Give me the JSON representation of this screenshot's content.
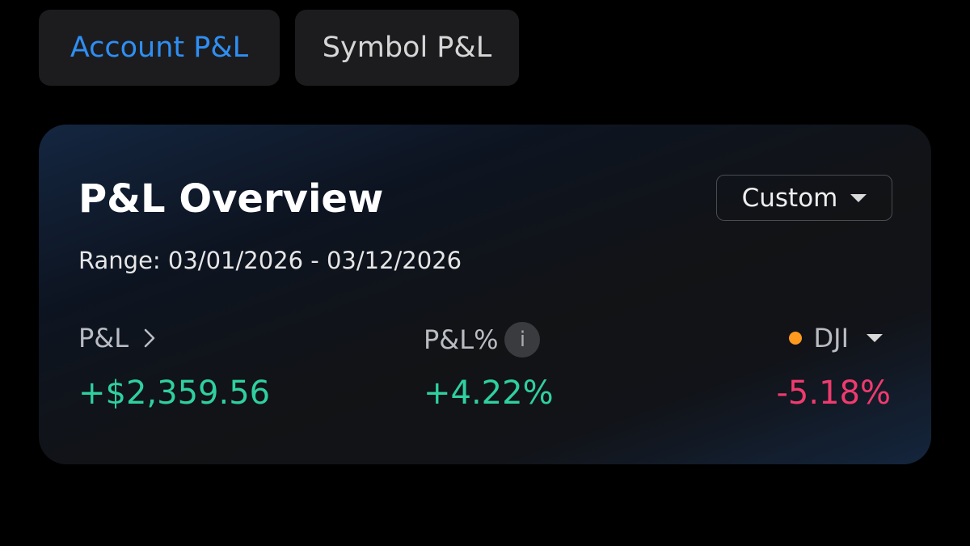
{
  "tabs": [
    {
      "label": "Account P&L",
      "active": true
    },
    {
      "label": "Symbol P&L",
      "active": false
    }
  ],
  "overview": {
    "title": "P&L Overview",
    "range": "Range: 03/01/2026 - 03/12/2026",
    "period_selector": {
      "selected": "Custom"
    },
    "metrics": {
      "pnl": {
        "label": "P&L",
        "value": "+$2,359.56"
      },
      "pnl_percent": {
        "label": "P&L%",
        "value": "+4.22%",
        "info_icon_text": "i"
      },
      "benchmark": {
        "label": "DJI",
        "value": "-5.18%",
        "dot_color": "#ff9a1f"
      }
    }
  },
  "colors": {
    "accent": "#2f8ef2",
    "positive": "#2fd0a0",
    "negative": "#f03a6e"
  },
  "icons": {
    "pnl_chevron": "chevron-right-icon",
    "dropdown": "triangle-down-icon",
    "info": "info-icon"
  }
}
